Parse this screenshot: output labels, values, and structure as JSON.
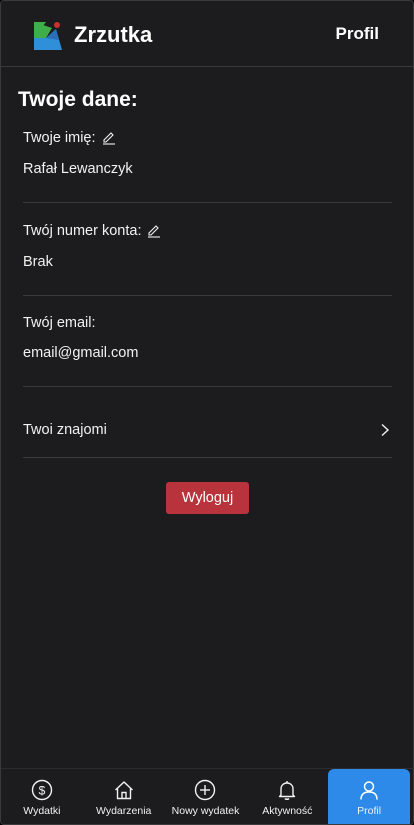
{
  "header": {
    "app_name": "Zrzutka",
    "title": "Profil"
  },
  "profile": {
    "section_title": "Twoje dane:",
    "name_label": "Twoje imię:",
    "name_value": "Rafał Lewanczyk",
    "account_label": "Twój numer konta:",
    "account_value": "Brak",
    "email_label": "Twój email:",
    "email_value": "email@gmail.com",
    "friends_label": "Twoi znajomi",
    "logout_label": "Wyloguj"
  },
  "bottom_nav": {
    "items": [
      {
        "label": "Wydatki",
        "icon": "dollar-circle-icon",
        "active": false
      },
      {
        "label": "Wydarzenia",
        "icon": "home-icon",
        "active": false
      },
      {
        "label": "Nowy wydatek",
        "icon": "plus-circle-icon",
        "active": false
      },
      {
        "label": "Aktywność",
        "icon": "bell-icon",
        "active": false
      },
      {
        "label": "Profil",
        "icon": "user-icon",
        "active": true
      }
    ]
  },
  "colors": {
    "background": "#1c1c1e",
    "accent": "#2d8ae8",
    "logout": "#b8333b",
    "logo_green": "#3fae49",
    "logo_blue": "#2f8fd8"
  }
}
